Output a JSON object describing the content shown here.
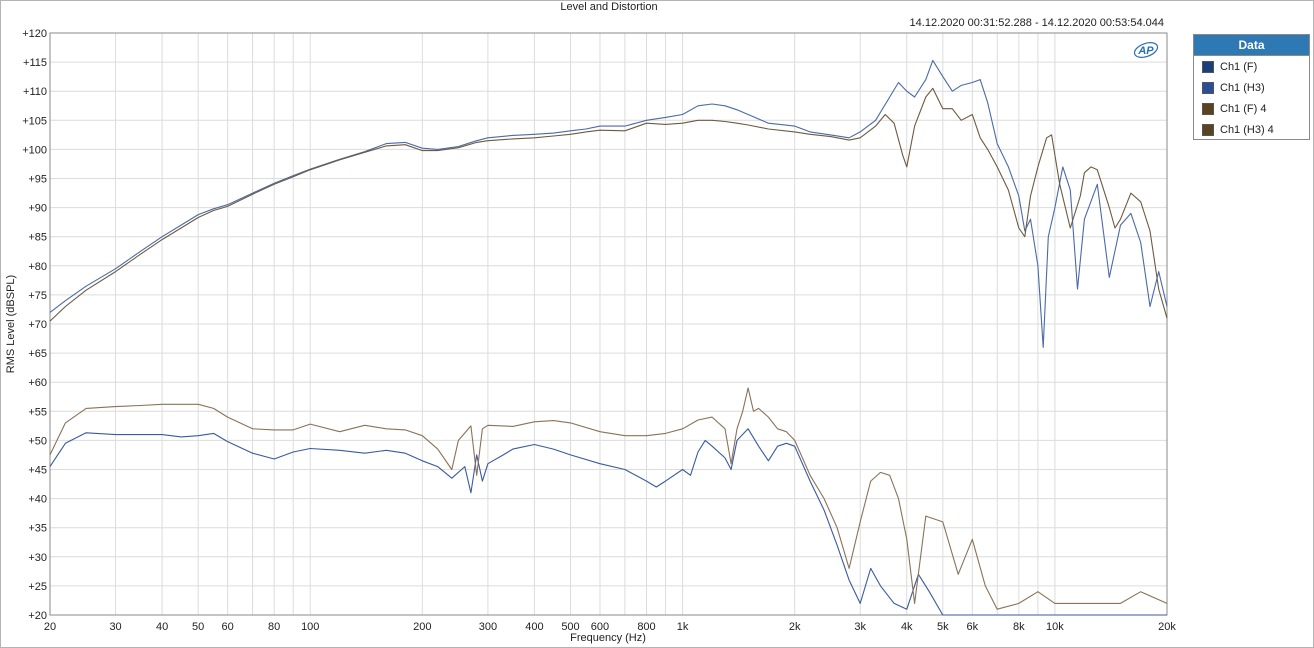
{
  "chart_data": {
    "type": "line",
    "title": "Level and Distortion",
    "subtitle": "14.12.2020 00:31:52.288 - 14.12.2020 00:53:54.044",
    "xlabel": "Frequency (Hz)",
    "ylabel": "RMS Level (dBSPL)",
    "xscale": "log",
    "xlim": [
      20,
      20000
    ],
    "ylim": [
      20,
      120
    ],
    "grid": true,
    "legend_position": "right",
    "x_ticks": [
      20,
      30,
      40,
      50,
      60,
      80,
      100,
      200,
      300,
      400,
      500,
      600,
      800,
      1000,
      2000,
      3000,
      4000,
      5000,
      6000,
      8000,
      10000,
      20000
    ],
    "x_tick_labels": [
      "20",
      "30",
      "40",
      "50",
      "60",
      "80",
      "100",
      "200",
      "300",
      "400",
      "500",
      "600",
      "800",
      "1k",
      "2k",
      "3k",
      "4k",
      "5k",
      "6k",
      "8k",
      "10k",
      "20k"
    ],
    "y_ticks": [
      20,
      25,
      30,
      35,
      40,
      45,
      50,
      55,
      60,
      65,
      70,
      75,
      80,
      85,
      90,
      95,
      100,
      105,
      110,
      115,
      120
    ],
    "y_tick_labels": [
      "+20",
      "+25",
      "+30",
      "+35",
      "+40",
      "+45",
      "+50",
      "+55",
      "+60",
      "+65",
      "+70",
      "+75",
      "+80",
      "+85",
      "+90",
      "+95",
      "+100",
      "+105",
      "+110",
      "+115",
      "+120"
    ],
    "series": [
      {
        "name": "Ch1 (F)",
        "color": "#4a6aa8",
        "points": [
          [
            20,
            72
          ],
          [
            22,
            74
          ],
          [
            25,
            76.5
          ],
          [
            30,
            79.5
          ],
          [
            35,
            82.5
          ],
          [
            40,
            85
          ],
          [
            45,
            87
          ],
          [
            50,
            88.8
          ],
          [
            55,
            89.8
          ],
          [
            60,
            90.5
          ],
          [
            70,
            92.5
          ],
          [
            80,
            94.2
          ],
          [
            90,
            95.5
          ],
          [
            100,
            96.6
          ],
          [
            120,
            98.3
          ],
          [
            140,
            99.6
          ],
          [
            160,
            101
          ],
          [
            180,
            101.2
          ],
          [
            200,
            100.2
          ],
          [
            220,
            100
          ],
          [
            250,
            100.5
          ],
          [
            280,
            101.5
          ],
          [
            300,
            102
          ],
          [
            350,
            102.4
          ],
          [
            400,
            102.6
          ],
          [
            450,
            102.8
          ],
          [
            500,
            103.2
          ],
          [
            550,
            103.5
          ],
          [
            600,
            104
          ],
          [
            700,
            104
          ],
          [
            800,
            105
          ],
          [
            900,
            105.5
          ],
          [
            1000,
            106
          ],
          [
            1100,
            107.5
          ],
          [
            1200,
            107.8
          ],
          [
            1300,
            107.5
          ],
          [
            1400,
            106.8
          ],
          [
            1500,
            106
          ],
          [
            1700,
            104.5
          ],
          [
            2000,
            104
          ],
          [
            2200,
            103
          ],
          [
            2500,
            102.5
          ],
          [
            2800,
            102
          ],
          [
            3000,
            103
          ],
          [
            3300,
            105
          ],
          [
            3600,
            109
          ],
          [
            3800,
            111.5
          ],
          [
            4000,
            110
          ],
          [
            4200,
            109
          ],
          [
            4500,
            112
          ],
          [
            4700,
            115.3
          ],
          [
            5000,
            112.5
          ],
          [
            5300,
            110
          ],
          [
            5600,
            111
          ],
          [
            6000,
            111.5
          ],
          [
            6300,
            112
          ],
          [
            6600,
            108
          ],
          [
            7000,
            101
          ],
          [
            7500,
            97
          ],
          [
            8000,
            92
          ],
          [
            8300,
            86
          ],
          [
            8600,
            88
          ],
          [
            9000,
            80
          ],
          [
            9300,
            66
          ],
          [
            9600,
            85
          ],
          [
            10000,
            90
          ],
          [
            10500,
            97
          ],
          [
            11000,
            93
          ],
          [
            11500,
            76
          ],
          [
            12000,
            88
          ],
          [
            13000,
            94
          ],
          [
            14000,
            78
          ],
          [
            15000,
            87
          ],
          [
            16000,
            89
          ],
          [
            17000,
            84
          ],
          [
            18000,
            73
          ],
          [
            19000,
            79
          ],
          [
            20000,
            73
          ]
        ]
      },
      {
        "name": "Ch1 (H3)",
        "color": "#3a5aa0",
        "points": [
          [
            20,
            45.5
          ],
          [
            22,
            49.5
          ],
          [
            25,
            51.3
          ],
          [
            30,
            51
          ],
          [
            35,
            51
          ],
          [
            40,
            51
          ],
          [
            45,
            50.6
          ],
          [
            50,
            50.8
          ],
          [
            55,
            51.2
          ],
          [
            60,
            49.8
          ],
          [
            70,
            47.8
          ],
          [
            80,
            46.8
          ],
          [
            90,
            48
          ],
          [
            100,
            48.6
          ],
          [
            120,
            48.3
          ],
          [
            140,
            47.8
          ],
          [
            160,
            48.3
          ],
          [
            180,
            47.8
          ],
          [
            200,
            46.5
          ],
          [
            220,
            45.5
          ],
          [
            240,
            43.5
          ],
          [
            260,
            45.5
          ],
          [
            270,
            41
          ],
          [
            280,
            47.5
          ],
          [
            290,
            43
          ],
          [
            300,
            46
          ],
          [
            330,
            47.5
          ],
          [
            350,
            48.5
          ],
          [
            400,
            49.3
          ],
          [
            450,
            48.5
          ],
          [
            500,
            47.5
          ],
          [
            600,
            46
          ],
          [
            700,
            45
          ],
          [
            800,
            43
          ],
          [
            850,
            42
          ],
          [
            900,
            43
          ],
          [
            1000,
            45
          ],
          [
            1050,
            44
          ],
          [
            1100,
            48
          ],
          [
            1150,
            50
          ],
          [
            1200,
            49
          ],
          [
            1300,
            47
          ],
          [
            1350,
            45
          ],
          [
            1400,
            50
          ],
          [
            1500,
            52
          ],
          [
            1600,
            49
          ],
          [
            1700,
            46.5
          ],
          [
            1800,
            49
          ],
          [
            1900,
            49.5
          ],
          [
            2000,
            49
          ],
          [
            2200,
            43
          ],
          [
            2400,
            38
          ],
          [
            2600,
            32
          ],
          [
            2800,
            26
          ],
          [
            3000,
            22
          ],
          [
            3200,
            28
          ],
          [
            3400,
            25
          ],
          [
            3700,
            22
          ],
          [
            4000,
            21
          ],
          [
            4300,
            27
          ],
          [
            4600,
            24
          ],
          [
            5000,
            20
          ],
          [
            6000,
            20
          ],
          [
            8000,
            20
          ],
          [
            10000,
            20
          ],
          [
            20000,
            20
          ]
        ]
      },
      {
        "name": "Ch1 (F) 4",
        "color": "#6e5a40",
        "points": [
          [
            20,
            70.5
          ],
          [
            22,
            73
          ],
          [
            25,
            75.8
          ],
          [
            30,
            79
          ],
          [
            35,
            82
          ],
          [
            40,
            84.5
          ],
          [
            45,
            86.5
          ],
          [
            50,
            88.3
          ],
          [
            55,
            89.5
          ],
          [
            60,
            90.2
          ],
          [
            70,
            92.3
          ],
          [
            80,
            94
          ],
          [
            90,
            95.3
          ],
          [
            100,
            96.5
          ],
          [
            120,
            98.2
          ],
          [
            140,
            99.5
          ],
          [
            160,
            100.6
          ],
          [
            180,
            100.8
          ],
          [
            200,
            99.8
          ],
          [
            220,
            99.8
          ],
          [
            250,
            100.3
          ],
          [
            280,
            101.2
          ],
          [
            300,
            101.5
          ],
          [
            350,
            101.8
          ],
          [
            400,
            102
          ],
          [
            450,
            102.3
          ],
          [
            500,
            102.6
          ],
          [
            550,
            103
          ],
          [
            600,
            103.3
          ],
          [
            700,
            103.2
          ],
          [
            800,
            104.5
          ],
          [
            900,
            104.3
          ],
          [
            1000,
            104.5
          ],
          [
            1100,
            105
          ],
          [
            1200,
            105
          ],
          [
            1300,
            104.8
          ],
          [
            1400,
            104.5
          ],
          [
            1500,
            104.2
          ],
          [
            1700,
            103.5
          ],
          [
            2000,
            103
          ],
          [
            2200,
            102.6
          ],
          [
            2500,
            102.2
          ],
          [
            2800,
            101.6
          ],
          [
            3000,
            102
          ],
          [
            3300,
            104
          ],
          [
            3500,
            106
          ],
          [
            3700,
            104.5
          ],
          [
            3900,
            99
          ],
          [
            4000,
            97
          ],
          [
            4200,
            104
          ],
          [
            4500,
            109
          ],
          [
            4700,
            110.5
          ],
          [
            5000,
            107
          ],
          [
            5300,
            107
          ],
          [
            5600,
            105
          ],
          [
            6000,
            106
          ],
          [
            6300,
            102
          ],
          [
            6600,
            100
          ],
          [
            7000,
            97
          ],
          [
            7500,
            93
          ],
          [
            8000,
            86.5
          ],
          [
            8300,
            85
          ],
          [
            8600,
            92
          ],
          [
            9000,
            97
          ],
          [
            9500,
            102
          ],
          [
            9800,
            102.5
          ],
          [
            10300,
            94
          ],
          [
            11000,
            86.5
          ],
          [
            11700,
            92
          ],
          [
            12000,
            96
          ],
          [
            12500,
            97
          ],
          [
            13000,
            96.5
          ],
          [
            14000,
            90
          ],
          [
            14500,
            86.5
          ],
          [
            15000,
            88
          ],
          [
            16000,
            92.5
          ],
          [
            17000,
            91
          ],
          [
            18000,
            86
          ],
          [
            19000,
            76
          ],
          [
            20000,
            71
          ]
        ]
      },
      {
        "name": "Ch1 (H3) 4",
        "color": "#8a7258",
        "points": [
          [
            20,
            47.5
          ],
          [
            22,
            53
          ],
          [
            25,
            55.5
          ],
          [
            30,
            55.8
          ],
          [
            35,
            56
          ],
          [
            40,
            56.2
          ],
          [
            45,
            56.2
          ],
          [
            50,
            56.2
          ],
          [
            55,
            55.5
          ],
          [
            60,
            54
          ],
          [
            70,
            52
          ],
          [
            80,
            51.8
          ],
          [
            90,
            51.8
          ],
          [
            100,
            52.8
          ],
          [
            120,
            51.5
          ],
          [
            140,
            52.6
          ],
          [
            160,
            52
          ],
          [
            180,
            51.8
          ],
          [
            200,
            50.8
          ],
          [
            220,
            48.5
          ],
          [
            240,
            45
          ],
          [
            250,
            50
          ],
          [
            270,
            52.5
          ],
          [
            280,
            44
          ],
          [
            290,
            52
          ],
          [
            300,
            52.6
          ],
          [
            350,
            52.4
          ],
          [
            400,
            53.2
          ],
          [
            450,
            53.4
          ],
          [
            500,
            53
          ],
          [
            600,
            51.5
          ],
          [
            700,
            50.8
          ],
          [
            800,
            50.8
          ],
          [
            900,
            51.2
          ],
          [
            1000,
            52
          ],
          [
            1100,
            53.5
          ],
          [
            1200,
            54
          ],
          [
            1300,
            52
          ],
          [
            1350,
            46
          ],
          [
            1400,
            52
          ],
          [
            1450,
            55
          ],
          [
            1500,
            59
          ],
          [
            1550,
            55
          ],
          [
            1600,
            55.5
          ],
          [
            1700,
            54
          ],
          [
            1800,
            52
          ],
          [
            1900,
            51.5
          ],
          [
            2000,
            50
          ],
          [
            2200,
            44
          ],
          [
            2400,
            40
          ],
          [
            2600,
            35
          ],
          [
            2800,
            28
          ],
          [
            3000,
            36
          ],
          [
            3200,
            43
          ],
          [
            3400,
            44.5
          ],
          [
            3600,
            44
          ],
          [
            3800,
            40
          ],
          [
            4000,
            33
          ],
          [
            4200,
            22
          ],
          [
            4500,
            37
          ],
          [
            5000,
            36
          ],
          [
            5500,
            27
          ],
          [
            6000,
            33
          ],
          [
            6500,
            25
          ],
          [
            7000,
            21
          ],
          [
            8000,
            22
          ],
          [
            9000,
            24
          ],
          [
            10000,
            22
          ],
          [
            12000,
            22
          ],
          [
            15000,
            22
          ],
          [
            17000,
            24
          ],
          [
            20000,
            22
          ]
        ]
      }
    ]
  },
  "legend": {
    "header": "Data",
    "items": [
      {
        "label": "Ch1 (F)",
        "color": "#1c3f7c"
      },
      {
        "label": "Ch1 (H3)",
        "color": "#2a4f96"
      },
      {
        "label": "Ch1 (F) 4",
        "color": "#5a4320"
      },
      {
        "label": "Ch1 (H3) 4",
        "color": "#5a4320"
      }
    ]
  },
  "logo": {
    "text": "AP"
  }
}
